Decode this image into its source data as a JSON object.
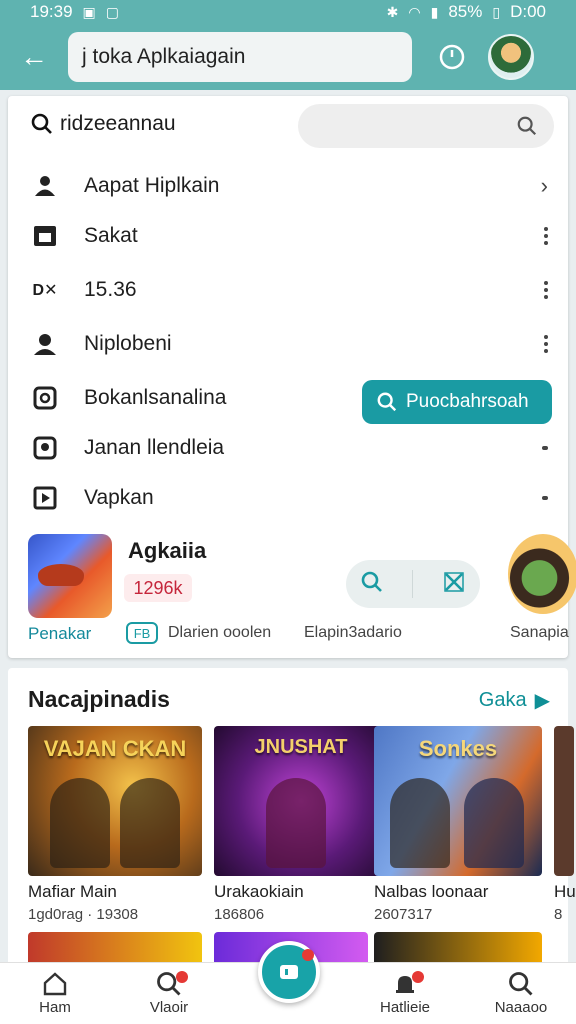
{
  "status_bar": {
    "time": "19:39",
    "battery": "85%",
    "clock_right": "D:00"
  },
  "app_bar": {
    "title": "j toka Aplkaiagain"
  },
  "menu": {
    "search_label": "ridzeeannau",
    "items": [
      {
        "label": "Aapat Hiplkain",
        "icon": "person-icon",
        "trail": "chevron"
      },
      {
        "label": "Sakat",
        "icon": "window-icon",
        "trail": "more"
      },
      {
        "label": "15.36",
        "icon": "dx-icon",
        "trail": "more"
      },
      {
        "label": "Niplobeni",
        "icon": "user-icon",
        "trail": "more"
      },
      {
        "label": "Bokanlsanalina",
        "icon": "archive-icon",
        "trail": "none"
      },
      {
        "label": "Janan llendleia",
        "icon": "speech-icon",
        "trail": "dot"
      },
      {
        "label": "Vapkan",
        "icon": "play-box-icon",
        "trail": "dot"
      }
    ],
    "search_button": "Puocbahrsoah"
  },
  "app_card": {
    "name": "Agkaiia",
    "count": "1296k",
    "meta": {
      "a": "Penakar",
      "tag": "FB",
      "b": "Dlarien ooolen",
      "c": "Elapin3adario",
      "d": "Sanapia"
    }
  },
  "games": {
    "title": "Nacajpinadis",
    "more": "Gaka",
    "tiles": [
      {
        "art": "VAJAN CKAN",
        "name": "Mafiar Main",
        "sub": "1gd0rag · 19308"
      },
      {
        "art": "JNUSHAT",
        "name": "Urakaokiain",
        "sub": "186806"
      },
      {
        "art": "Sonkes",
        "name": "Nalbas loonaar",
        "sub": "2607317"
      },
      {
        "art": "",
        "name": "Hu",
        "sub": "8"
      }
    ]
  },
  "bottom_nav": {
    "items": [
      {
        "label": "Ham"
      },
      {
        "label": "Vlaoir"
      },
      {
        "label": "Hatlieie"
      },
      {
        "label": "Naaaoo"
      }
    ]
  },
  "colors": {
    "teal": "#1a9ba3",
    "header": "#5fb3b0",
    "badge": "#e53935"
  }
}
